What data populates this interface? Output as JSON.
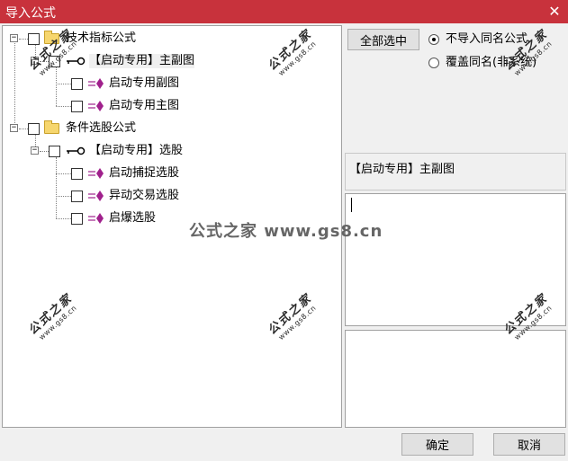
{
  "window": {
    "title": "导入公式",
    "close_symbol": "✕"
  },
  "tree": {
    "groups": [
      {
        "label": "技术指标公式",
        "children": [
          {
            "label": "【启动专用】主副图",
            "selected": true,
            "children": [
              {
                "label": "启动专用副图"
              },
              {
                "label": "启动专用主图"
              }
            ]
          }
        ]
      },
      {
        "label": "条件选股公式",
        "children": [
          {
            "label": "【启动专用】选股",
            "children": [
              {
                "label": "启动捕捉选股"
              },
              {
                "label": "异动交易选股"
              },
              {
                "label": "启爆选股"
              }
            ]
          }
        ]
      }
    ]
  },
  "options": {
    "select_all_label": "全部选中",
    "radio_options": [
      {
        "label": "不导入同名公式",
        "checked": true
      },
      {
        "label": "覆盖同名(非系统)",
        "checked": false
      }
    ]
  },
  "detail": {
    "name": "【启动专用】主副图",
    "description": "",
    "notes": ""
  },
  "footer": {
    "ok_label": "确定",
    "cancel_label": "取消"
  },
  "watermark": {
    "main": "公式之家",
    "sub": "www.gs8.cn",
    "banner": "公式之家 www.gs8.cn"
  },
  "colors": {
    "titlebar": "#c8323c",
    "formula_icon": "#a0208c",
    "folder": "#f6d66e"
  }
}
